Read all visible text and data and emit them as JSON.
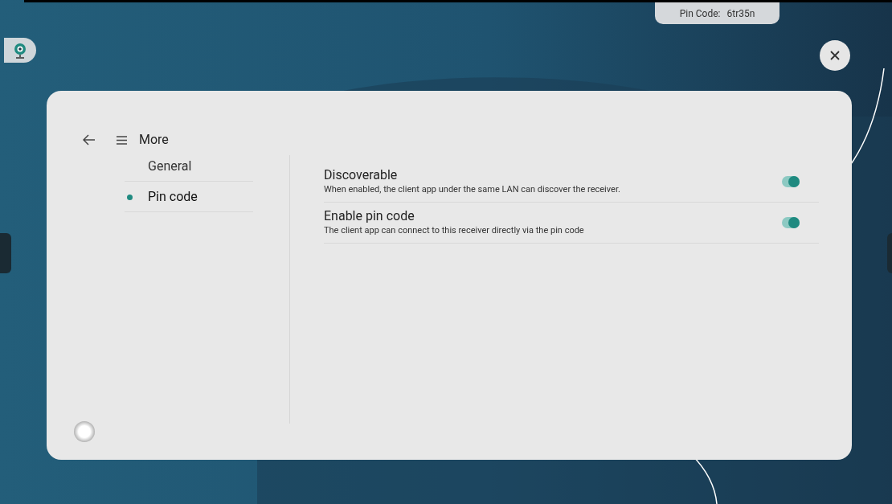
{
  "pin_badge": {
    "label": "Pin Code:",
    "value": "6tr35n"
  },
  "header": {
    "title": "More"
  },
  "nav": [
    {
      "label": "General",
      "selected": false
    },
    {
      "label": "Pin code",
      "selected": true
    }
  ],
  "settings": [
    {
      "title": "Discoverable",
      "description": "When enabled, the client app under the same LAN can discover the receiver.",
      "on": true
    },
    {
      "title": "Enable pin code",
      "description": "The client app can connect to this receiver directly via the pin code",
      "on": true
    }
  ]
}
